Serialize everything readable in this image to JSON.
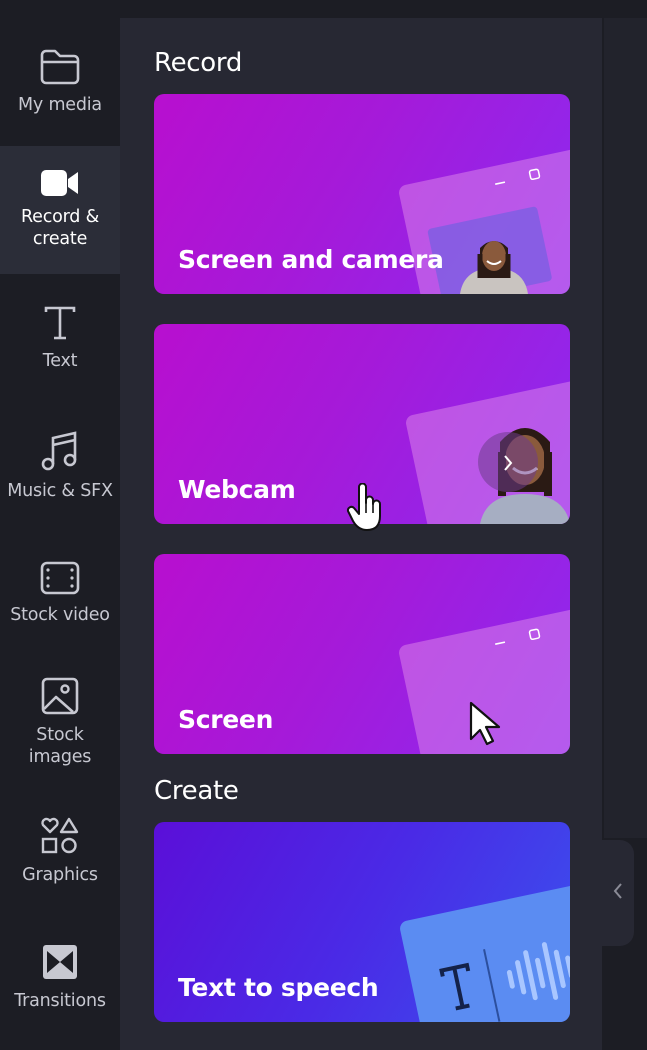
{
  "nav": {
    "items": [
      {
        "label": "My media",
        "icon": "folder-icon",
        "active": false
      },
      {
        "label": "Record & create",
        "icon": "video-camera-icon",
        "active": true
      },
      {
        "label": "Text",
        "icon": "text-icon",
        "active": false
      },
      {
        "label": "Music & SFX",
        "icon": "music-note-icon",
        "active": false
      },
      {
        "label": "Stock video",
        "icon": "film-icon",
        "active": false
      },
      {
        "label": "Stock images",
        "icon": "image-icon",
        "active": false
      },
      {
        "label": "Graphics",
        "icon": "shapes-icon",
        "active": false
      },
      {
        "label": "Transitions",
        "icon": "transitions-icon",
        "active": false
      }
    ]
  },
  "record": {
    "title": "Record",
    "cards": [
      {
        "label": "Screen and camera"
      },
      {
        "label": "Webcam"
      },
      {
        "label": "Screen"
      }
    ]
  },
  "create": {
    "title": "Create",
    "cards": [
      {
        "label": "Text to speech"
      }
    ]
  },
  "colors": {
    "nav_bg": "#1c1d24",
    "panel_bg": "#272833",
    "active_bg": "#2b2d38",
    "record_card_gradient": [
      "#b80fcf",
      "#8c2af0"
    ],
    "create_card_gradient": [
      "#5b0fd8",
      "#3a52ee"
    ]
  }
}
